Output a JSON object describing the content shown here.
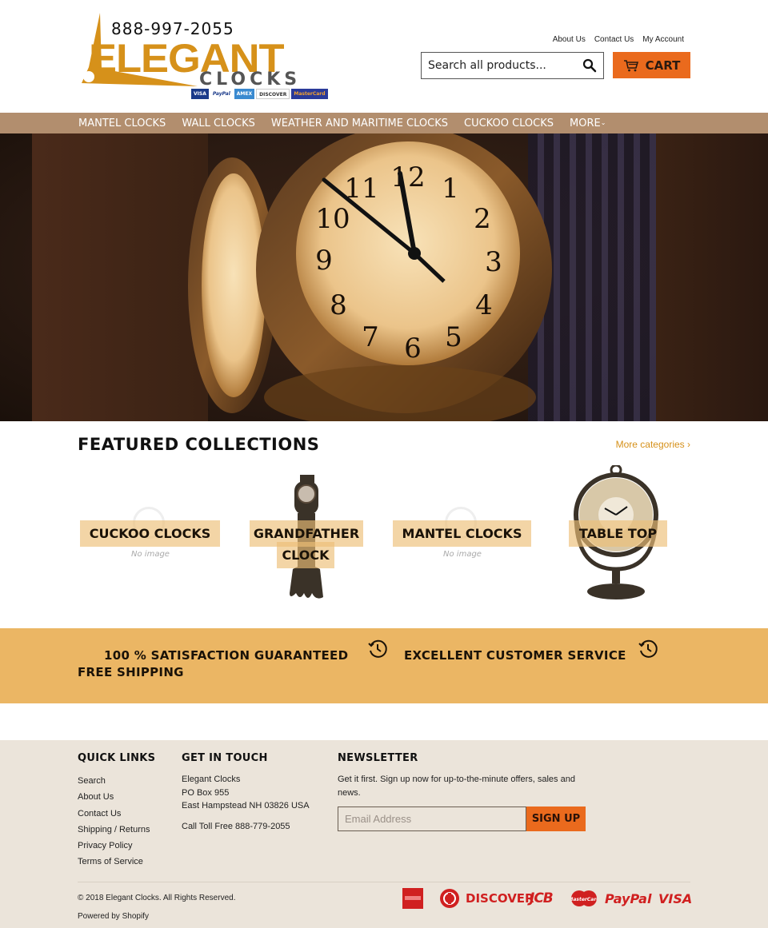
{
  "header": {
    "logo": {
      "phone": "888-997-2055",
      "brand": "ELEGANT",
      "subbrand": "CLOCKS",
      "card_badges": [
        "VISA",
        "PayPal",
        "AMEX",
        "DISCOVER",
        "MasterCard"
      ]
    },
    "top_links": [
      "About Us",
      "Contact Us",
      "My Account"
    ],
    "search": {
      "placeholder": "Search all products...",
      "value": ""
    },
    "cart_label": "CART"
  },
  "nav": {
    "items": [
      "MANTEL CLOCKS",
      "WALL CLOCKS",
      "WEATHER AND MARITIME CLOCKS",
      "CUCKOO CLOCKS",
      "MORE"
    ]
  },
  "hero": {
    "description": "Large illuminated station clock, hands near 11:55"
  },
  "featured": {
    "title": "FEATURED COLLECTIONS",
    "more_link": "More categories ›",
    "no_image_text": "No image",
    "collections": [
      {
        "label": "CUCKOO CLOCKS",
        "has_image": false
      },
      {
        "label_line1": "GRANDFATHER",
        "label_line2": "CLOCK",
        "has_image": true
      },
      {
        "label": "MANTEL CLOCKS",
        "has_image": false
      },
      {
        "label": "TABLE TOP",
        "has_image": true
      }
    ]
  },
  "features_band": {
    "items": [
      "100 %  SATISFACTION GUARANTEED",
      "EXCELLENT CUSTOMER SERVICE",
      "FREE SHIPPING"
    ]
  },
  "footer": {
    "quick_links": {
      "title": "QUICK LINKS",
      "items": [
        "Search",
        "About Us",
        "Contact Us",
        "Shipping / Returns",
        "Privacy Policy",
        "Terms of Service"
      ]
    },
    "get_in_touch": {
      "title": "GET IN TOUCH",
      "lines": [
        "Elegant Clocks",
        "PO Box 955",
        "East Hampstead NH 03826 USA"
      ],
      "phone": "Call Toll Free 888-779-2055"
    },
    "newsletter": {
      "title": "NEWSLETTER",
      "text": "Get it first. Sign up now for up-to-the-minute offers, sales and news.",
      "email_placeholder": "Email Address",
      "button": "SIGN UP"
    },
    "copyright": "© 2018 Elegant Clocks. All Rights Reserved.",
    "powered_by": "Powered by Shopify",
    "payment_icons": [
      "American Express",
      "Diners Club",
      "DISCOVER",
      "JCB",
      "MasterCard",
      "PayPal",
      "VISA"
    ]
  },
  "colors": {
    "accent_orange": "#ea6a1d",
    "brand_gold": "#d6911a",
    "nav_bg": "#b28e6e",
    "band_bg": "#ebb664",
    "footer_bg": "#ebe4da"
  }
}
